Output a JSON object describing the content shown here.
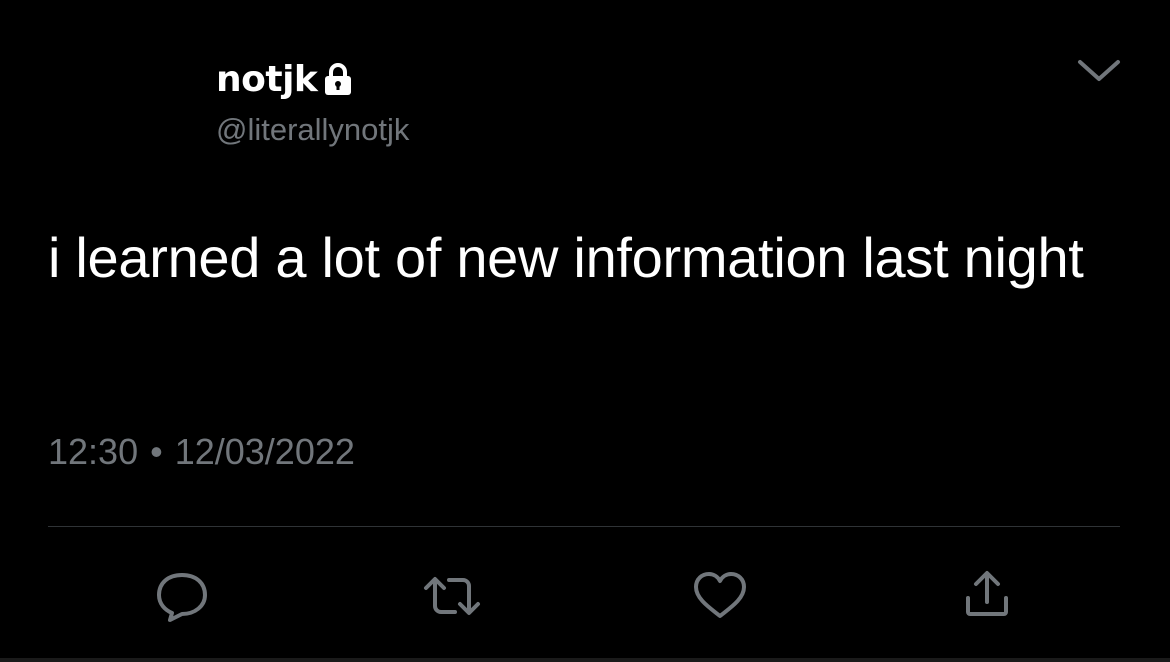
{
  "tweet": {
    "display_name": "notjk",
    "handle": "@literallynotjk",
    "text": "i learned a lot of new information last night",
    "time": "12:30",
    "separator": "•",
    "date": "12/03/2022"
  },
  "icons": {
    "lock": "lock-icon",
    "more": "chevron-down-icon",
    "reply": "reply-icon",
    "retweet": "retweet-icon",
    "like": "heart-icon",
    "share": "share-icon"
  },
  "colors": {
    "background": "#000000",
    "primary_text": "#ffffff",
    "secondary_text": "#71767b",
    "divider": "#2f3336"
  }
}
